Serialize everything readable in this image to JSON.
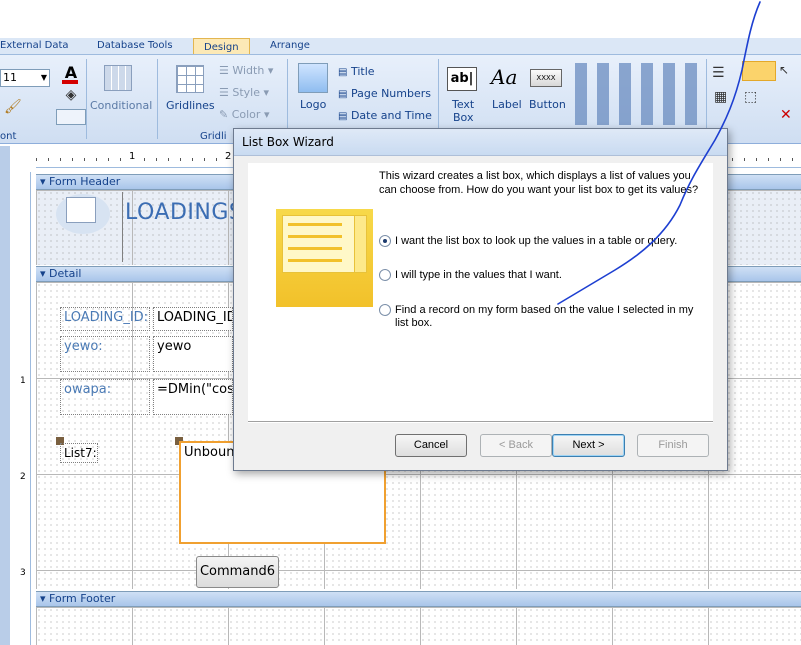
{
  "ribbon": {
    "tabs": [
      "External Data",
      "Database Tools",
      "Design",
      "Arrange"
    ],
    "font_size": "11",
    "font_group_label": "ont",
    "conditional_label": "Conditional",
    "gridlines_label": "Gridlines",
    "gridlines_group_label": "Gridli",
    "width_label": "Width",
    "style_label": "Style",
    "color_label": "Color",
    "logo_label": "Logo",
    "title_label": "Title",
    "page_numbers_label": "Page Numbers",
    "date_time_label": "Date and Time",
    "textbox_label_1": "Text",
    "textbox_label_2": "Box",
    "label_label": "Label",
    "button_label": "Button",
    "textbox_glyph": "ab|",
    "label_glyph": "Aa",
    "button_glyph": "XXXX"
  },
  "form": {
    "sections": {
      "header": "Form Header",
      "detail": "Detail",
      "footer": "Form Footer"
    },
    "header_title": "LOADINGS",
    "controls": {
      "loading_id_label": "LOADING_ID:",
      "loading_id_value": "LOADING_ID",
      "yewo_label": "yewo:",
      "yewo_value": "yewo",
      "owapa_label": "owapa:",
      "owapa_value": "=DMin(\"cost",
      "list7_label": "List7:",
      "listbox_value": "Unboun",
      "command_label": "Command6"
    },
    "ruler_numbers": [
      "1",
      "2"
    ],
    "left_ruler_numbers": [
      "1",
      "2",
      "3"
    ]
  },
  "dialog": {
    "title": "List Box Wizard",
    "intro": "This wizard creates a list box, which displays a list of values you can choose from.  How do you want your list box to get its values?",
    "options": [
      {
        "label": "I want the list box to look up the values in a table or query.",
        "checked": true
      },
      {
        "label": "I will type in the values that I want.",
        "checked": false
      },
      {
        "label": "Find a record on my form based on the value I selected in my list box.",
        "checked": false
      }
    ],
    "buttons": {
      "cancel": "Cancel",
      "back": "< Back",
      "next": "Next >",
      "finish": "Finish"
    }
  },
  "colors": {
    "accent": "#15428b",
    "pen": "#1d3fd1",
    "selection": "#f0a030"
  }
}
